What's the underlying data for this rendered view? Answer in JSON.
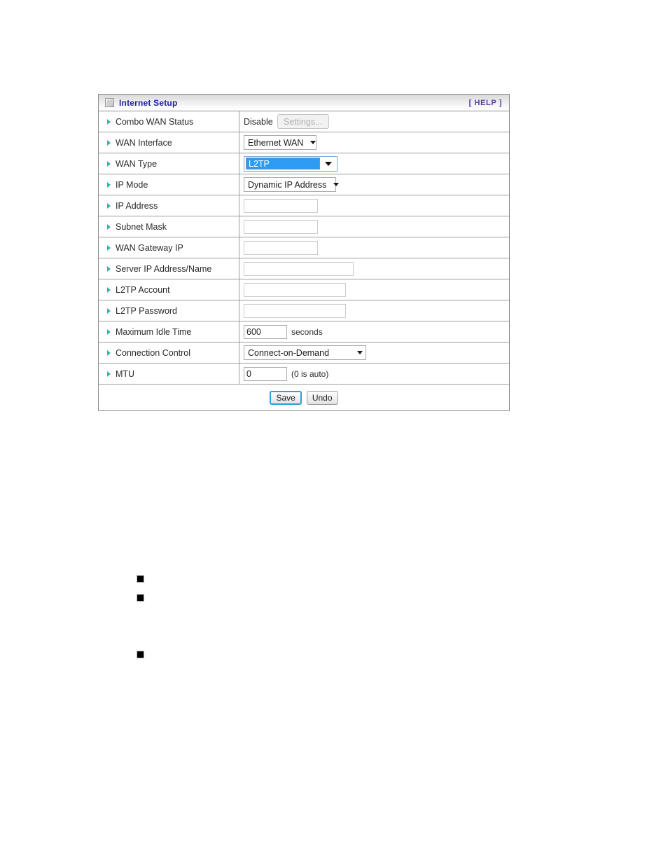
{
  "panel": {
    "header": {
      "icon": "window-icon",
      "title": "Internet Setup",
      "help_label": "[ HELP ]"
    },
    "rows": [
      {
        "label": "Combo WAN Status",
        "static_value": "Disable",
        "button_label": "Settings..."
      },
      {
        "label": "WAN Interface",
        "select_value": "Ethernet WAN"
      },
      {
        "label": "WAN Type",
        "select_value": "L2TP"
      },
      {
        "label": "IP Mode",
        "select_value": "Dynamic IP Address"
      },
      {
        "label": "IP Address",
        "input_value": ""
      },
      {
        "label": "Subnet Mask",
        "input_value": ""
      },
      {
        "label": "WAN Gateway IP",
        "input_value": ""
      },
      {
        "label": "Server IP Address/Name",
        "input_value": ""
      },
      {
        "label": "L2TP Account",
        "input_value": ""
      },
      {
        "label": "L2TP Password",
        "input_value": ""
      },
      {
        "label": "Maximum Idle Time",
        "input_value": "600",
        "unit": "seconds"
      },
      {
        "label": "Connection Control",
        "select_value": "Connect-on-Demand"
      },
      {
        "label": "MTU",
        "input_value": "0",
        "unit": "(0 is auto)"
      }
    ],
    "footer": {
      "save_label": "Save",
      "undo_label": "Undo"
    }
  },
  "body_bullets": [
    {
      "marker": "■"
    },
    {
      "marker": "■"
    },
    {
      "marker": "■"
    }
  ],
  "colors": {
    "title": "#22229c",
    "help": "#5c3fa6",
    "bullet": "#2fb6a8",
    "selection": "#2e9cf4",
    "save_focus": "#2f9fd6"
  }
}
